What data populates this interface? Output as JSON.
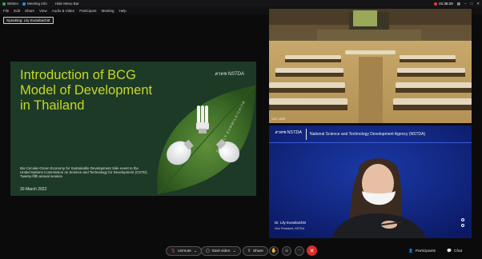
{
  "titlebar": {
    "tabs": [
      {
        "label": "Webex",
        "color": "#2bb24c"
      },
      {
        "label": "Meeting Info",
        "color": "#2a8cf0"
      },
      {
        "label": "Hide Menu Bar",
        "color": "#888888"
      }
    ],
    "recording_time": "01:36:29"
  },
  "menu": [
    "File",
    "Edit",
    "Share",
    "View",
    "Audio & Video",
    "Participant",
    "Meeting",
    "Help"
  ],
  "speaking_badge": "Speaking: Lily Eurwilaichitr",
  "slide": {
    "title": "Introduction of BCG Model of Development in Thailand",
    "logo": "สวทช NSTDA",
    "subtitle": "Bio-Circular-Green Economy for Sustainable Development Side event to the United Nations Commission on Science and Technology for Development (CSTD) Twenty-fifth annual session",
    "date": "30 March 2022",
    "signature": "DR. LILY EURWILAICHITR",
    "accent": "#c6d82a"
  },
  "hall": {
    "label": "1227-1505"
  },
  "speaker": {
    "logo": "สวทช NSTDA",
    "header": "National Science and Technology Development Agency (NSTDA)",
    "name": "Dr. Lily Eurwilaichitr",
    "title": "Vice President, NSTDA"
  },
  "controls": {
    "unmute": "Unmute",
    "start_video": "Start video",
    "share": "Share",
    "participants": "Participants",
    "chat": "Chat"
  }
}
